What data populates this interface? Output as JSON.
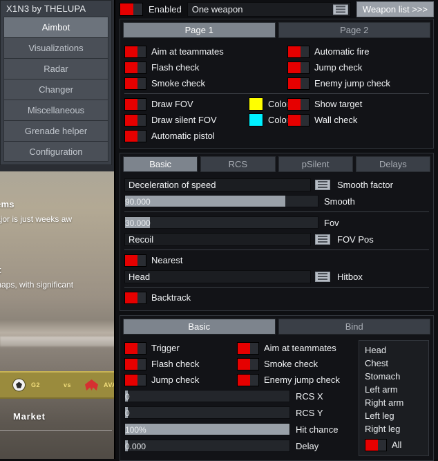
{
  "background": {
    "heading_a": "ment Items",
    "para_a": "erlin Major is just weeks aw",
    "heading_b": "ent",
    "para_b": "out maps, with significant",
    "team_left": "G2",
    "vs": "vs",
    "team_right": "AVA",
    "market": "Market"
  },
  "sidebar": {
    "title": "X1N3 by THELUPA",
    "items": [
      {
        "label": "Aimbot",
        "active": true
      },
      {
        "label": "Visualizations",
        "active": false
      },
      {
        "label": "Radar",
        "active": false
      },
      {
        "label": "Changer",
        "active": false
      },
      {
        "label": "Miscellaneous",
        "active": false
      },
      {
        "label": "Grenade helper",
        "active": false
      },
      {
        "label": "Configuration",
        "active": false
      }
    ]
  },
  "topbar": {
    "enabled_label": "Enabled",
    "enabled_on": true,
    "weapon_selected": "One weapon",
    "weapon_list_button": "Weapon list >>>"
  },
  "pages": {
    "tabs": [
      {
        "label": "Page 1",
        "active": true
      },
      {
        "label": "Page 2",
        "active": false
      }
    ],
    "group1_left": [
      {
        "label": "Aim at teammates",
        "on": true
      },
      {
        "label": "Flash check",
        "on": true
      },
      {
        "label": "Smoke check",
        "on": true
      }
    ],
    "group1_right": [
      {
        "label": "Automatic fire",
        "on": true
      },
      {
        "label": "Jump check",
        "on": true
      },
      {
        "label": "Enemy jump check",
        "on": true
      }
    ],
    "group2_left": [
      {
        "label": "Draw FOV",
        "on": true
      },
      {
        "label": "Draw silent FOV",
        "on": true
      },
      {
        "label": "Automatic pistol",
        "on": true
      }
    ],
    "group2_colors": [
      {
        "label": "Color",
        "hex": "#ffff00"
      },
      {
        "label": "Color",
        "hex": "#00f0ff"
      }
    ],
    "group2_right": [
      {
        "label": "Show target",
        "on": true
      },
      {
        "label": "Wall check",
        "on": true
      }
    ]
  },
  "aim": {
    "tabs": [
      {
        "label": "Basic",
        "active": true
      },
      {
        "label": "RCS",
        "active": false
      },
      {
        "label": "pSilent",
        "active": false
      },
      {
        "label": "Delays",
        "active": false
      }
    ],
    "smooth_factor": {
      "value": "Deceleration of speed",
      "label": "Smooth factor"
    },
    "smooth": {
      "value": "90.000",
      "label": "Smooth",
      "fill_percent": 83
    },
    "fov": {
      "value": "30.000",
      "label": "Fov",
      "fill_percent": 13
    },
    "fov_pos": {
      "value": "Recoil",
      "label": "FOV Pos"
    },
    "nearest": {
      "label": "Nearest",
      "on": true
    },
    "hitbox": {
      "value": "Head",
      "label": "Hitbox"
    },
    "backtrack": {
      "label": "Backtrack",
      "on": true
    }
  },
  "trigger": {
    "tabs": [
      {
        "label": "Basic",
        "active": true
      },
      {
        "label": "Bind",
        "active": false
      }
    ],
    "checks_left": [
      {
        "label": "Trigger",
        "on": true
      },
      {
        "label": "Flash check",
        "on": true
      },
      {
        "label": "Jump check",
        "on": true
      }
    ],
    "checks_right": [
      {
        "label": "Aim at teammates",
        "on": true
      },
      {
        "label": "Smoke check",
        "on": true
      },
      {
        "label": "Enemy jump check",
        "on": true
      }
    ],
    "sliders": [
      {
        "value": "0",
        "label": "RCS X",
        "fill_percent": 1
      },
      {
        "value": "0",
        "label": "RCS Y",
        "fill_percent": 1
      },
      {
        "value": "100%",
        "label": "Hit chance",
        "fill_percent": 100
      },
      {
        "value": "0.000",
        "label": "Delay",
        "fill_percent": 1
      }
    ],
    "hitboxes": [
      "Head",
      "Chest",
      "Stomach",
      "Left arm",
      "Right arm",
      "Left leg",
      "Right leg"
    ],
    "all": {
      "label": "All",
      "on": true
    }
  },
  "colors": {
    "accent_red": "#e60000",
    "panel_bg": "#121317",
    "tab_active": "#7d848d",
    "slider_fill": "#9aa1a9"
  }
}
